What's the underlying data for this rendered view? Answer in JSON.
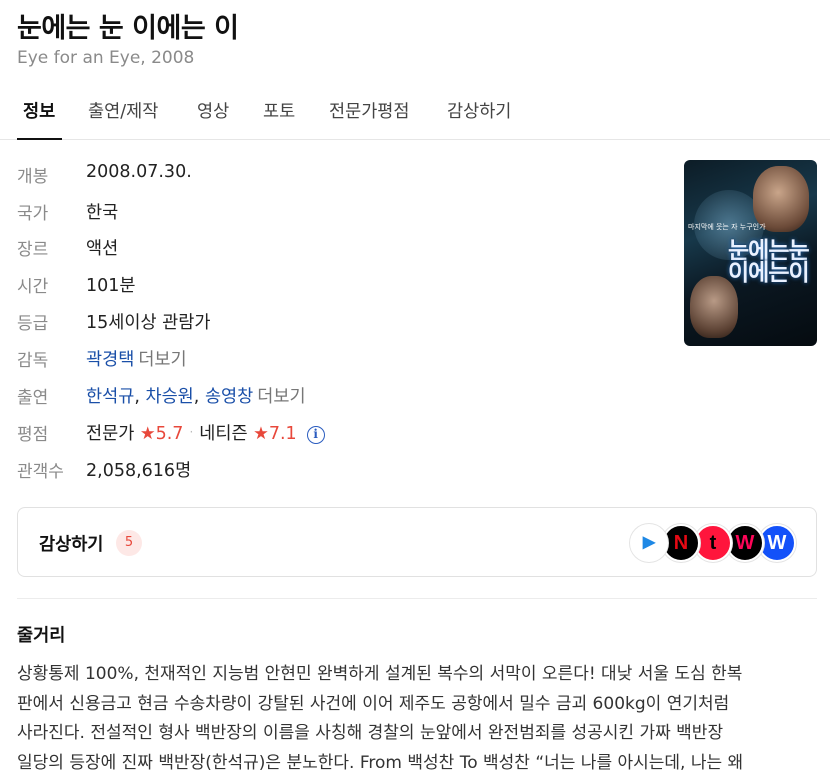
{
  "title": "눈에는 눈 이에는 이",
  "subtitle": "Eye for an Eye, 2008",
  "tabs": [
    "정보",
    "출연/제작",
    "영상",
    "포토",
    "전문가평점",
    "감상하기"
  ],
  "info": {
    "release": {
      "label": "개봉",
      "value": "2008.07.30."
    },
    "country": {
      "label": "국가",
      "value": "한국"
    },
    "genre": {
      "label": "장르",
      "value": "액션"
    },
    "runtime": {
      "label": "시간",
      "value": "101분"
    },
    "rating": {
      "label": "등급",
      "value": "15세이상 관람가"
    },
    "director": {
      "label": "감독",
      "name": "곽경택",
      "more": "더보기"
    },
    "cast": {
      "label": "출연",
      "names": [
        "한석규",
        "차승원",
        "송영창"
      ],
      "separator": ",",
      "more": "더보기"
    },
    "score": {
      "label": "평점",
      "critic_label": "전문가",
      "critic_star": "★",
      "critic_score": "5.7",
      "dot": "·",
      "netizen_label": "네티즌",
      "netizen_star": "★",
      "netizen_score": "7.1",
      "info_icon": "i"
    },
    "audience": {
      "label": "관객수",
      "value": "2,058,616명"
    }
  },
  "poster": {
    "text_line1": "눈에는눈",
    "text_line2": "이에는이",
    "tagline": "마지막에 웃는 자 누구인가"
  },
  "watch": {
    "title": "감상하기",
    "count": "5",
    "providers": [
      {
        "name": "play-icon",
        "glyph": "▶",
        "color": "#ffffff",
        "fg": "#1e88e5"
      },
      {
        "name": "netflix-icon",
        "glyph": "N",
        "color": "#000000",
        "fg": "#e50914"
      },
      {
        "name": "tving-icon",
        "glyph": "t",
        "color": "#ff153c",
        "fg": "#000000"
      },
      {
        "name": "watcha-icon",
        "glyph": "W",
        "color": "#000000",
        "fg": "#ff0558"
      },
      {
        "name": "wavve-icon",
        "glyph": "W",
        "color": "#1351f9",
        "fg": "#ffffff"
      }
    ]
  },
  "synopsis": {
    "title": "줄거리",
    "lines": [
      "상황통제 100%, 천재적인 지능범 안현민 완벽하게 설계된 복수의 서막이 오른다! 대낮 서울 도심 한복",
      "판에서 신용금고 현금 수송차량이 강탈된 사건에 이어 제주도 공항에서 밀수 금괴 600kg이 연기처럼",
      "사라진다. 전설적인 형사 백반장의 이름을 사칭해 경찰의 눈앞에서 완전범죄를 성공시킨 가짜 백반장",
      "일당의 등장에 진짜 백반장(한석규)은 분노한다. From 백성찬 To 백성찬 “너는 나를 아시는데, 나는 왜"
    ]
  }
}
